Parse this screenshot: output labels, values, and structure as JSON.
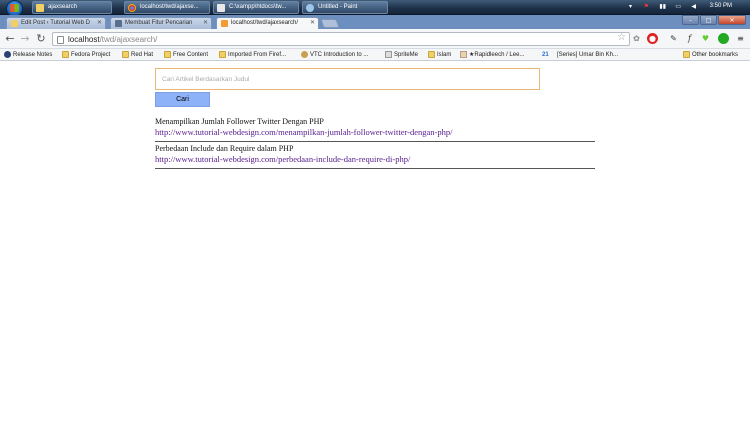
{
  "taskbar": {
    "windows": [
      {
        "label": "ajaxsearch"
      },
      {
        "label": "localhost/twd/ajaxse..."
      },
      {
        "label": "C:\\xampp\\htdocs\\tw..."
      },
      {
        "label": "Untitled - Paint"
      }
    ],
    "clock": "3:50 PM"
  },
  "browser": {
    "tabs": [
      {
        "label": "Edit Post ‹ Tutorial Web D"
      },
      {
        "label": "Membuat Fitur Pencarian"
      },
      {
        "label": "localhost/twd/ajaxsearch/"
      }
    ],
    "url": {
      "host": "localhost",
      "path": "/twd/ajaxsearch/"
    },
    "bookmarks": [
      {
        "label": "Release Notes",
        "icon": "fedora-icon"
      },
      {
        "label": "Fedora Project",
        "icon": "folder-icon"
      },
      {
        "label": "Red Hat",
        "icon": "folder-icon"
      },
      {
        "label": "Free Content",
        "icon": "folder-icon"
      },
      {
        "label": "Imported From Firef...",
        "icon": "folder-icon"
      },
      {
        "label": "VTC Introduction to ...",
        "icon": "page-icon"
      },
      {
        "label": "SpriteMe",
        "icon": "page-icon"
      },
      {
        "label": "Islam",
        "icon": "folder-icon"
      },
      {
        "label": "★Rapidleech / Lee...",
        "icon": "page-icon"
      },
      {
        "label": "[Series] Umar Bin Kh...",
        "icon": "page-icon"
      }
    ],
    "other_bookmarks": "Other bookmarks",
    "twenty_one": "21"
  },
  "page": {
    "search": {
      "placeholder": "Cari Artikel Berdasarkan Judul",
      "value": ""
    },
    "search_button": "Cari",
    "results": [
      {
        "title": "Menampilkan Jumlah Follower Twitter Dengan PHP",
        "url": "http://www.tutorial-webdesign.com/menampilkan-jumlah-follower-twitter-dengan-php/"
      },
      {
        "title": "Perbedaan Include dan Require dalam PHP",
        "url": "http://www.tutorial-webdesign.com/perbedaan-include-dan-require-di-php/"
      }
    ]
  }
}
